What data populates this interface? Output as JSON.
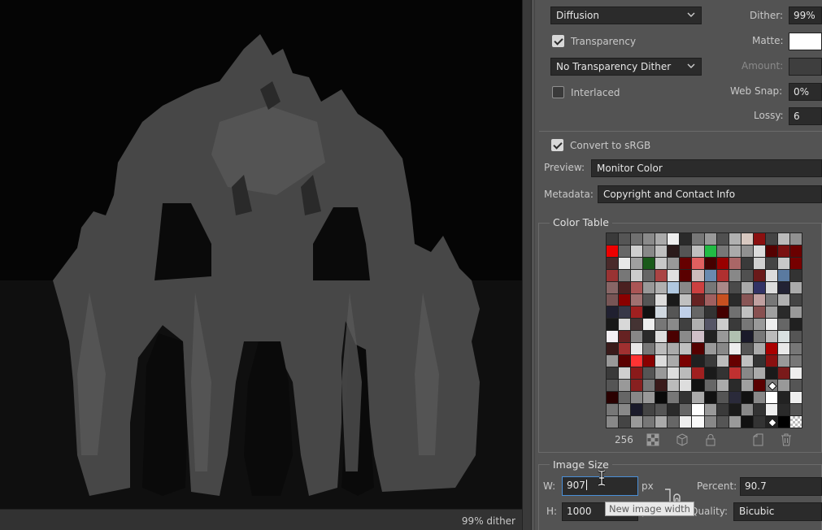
{
  "status": {
    "dither_readout": "99% dither"
  },
  "options": {
    "dither_algorithm": "Diffusion",
    "dither_label": "Dither:",
    "dither_value": "99%",
    "transparency_label": "Transparency",
    "transparency_checked": true,
    "matte_label": "Matte:",
    "matte_color": "#ffffff",
    "transparency_dither": "No Transparency Dither",
    "amount_label": "Amount:",
    "amount_value": "",
    "interlaced_label": "Interlaced",
    "interlaced_checked": false,
    "websnap_label": "Web Snap:",
    "websnap_value": "0%",
    "lossy_label": "Lossy:",
    "lossy_value": "6",
    "srgb_label": "Convert to sRGB",
    "srgb_checked": true,
    "preview_label": "Preview:",
    "preview_value": "Monitor Color",
    "metadata_label": "Metadata:",
    "metadata_value": "Copyright and Contact Info"
  },
  "color_table": {
    "title": "Color Table",
    "count": "256",
    "icons": [
      "web-shift-icon",
      "snap-to-web-icon",
      "lock-color-icon",
      "new-color-icon",
      "trash-icon"
    ],
    "palette": [
      "#3a3a3a",
      "#555",
      "#707070",
      "#8a8a8a",
      "#aaa",
      "#eee",
      "#2a2a2a",
      "#777",
      "#999",
      "#505050",
      "#b0b0b0",
      "#d8c8c0",
      "#8b1010",
      "#444",
      "#bbb",
      "#909090",
      "#e00",
      "#666",
      "#cfcfcf",
      "#888",
      "#c0c0c0",
      "#2a1a1a",
      "#555",
      "#bfbfbf",
      "#22bb44",
      "#777",
      "#aaa",
      "#909090",
      "#dcdcdc",
      "#500",
      "#7a1010",
      "#6a0000",
      "#4a2a2a",
      "#e8e8e8",
      "#a0a0a0",
      "#1a5a1a",
      "#c8c8c8",
      "#999",
      "#600",
      "#e06060",
      "#400",
      "#900",
      "#a66",
      "#3a3a3a",
      "#d0d0d0",
      "#444",
      "#c8c8c8",
      "#700",
      "#993333",
      "#777",
      "#ccc",
      "#666",
      "#aa4444",
      "#e0e0e0",
      "#5a0000",
      "#ccbbbb",
      "#6a8ab0",
      "#b03030",
      "#888",
      "#505050",
      "#6a1a1a",
      "#dcdcdc",
      "#5a7aa0",
      "#333",
      "#886666",
      "#4a2020",
      "#aa5555",
      "#999",
      "#b0b0b0",
      "#b0c8e0",
      "#888",
      "#cc4040",
      "#777",
      "#a88",
      "#4a4a4a",
      "#aaa",
      "#336",
      "#dcdcdc",
      "#223",
      "#aaa",
      "#775555",
      "#8a0000",
      "#a07070",
      "#555",
      "#dcdcdc",
      "#1a1a1a",
      "#c0c0c0",
      "#662222",
      "#a06060",
      "#c85020",
      "#2a2a2a",
      "#885555",
      "#c0a0a0",
      "#777",
      "#b0b0b0",
      "#444",
      "#202030",
      "#383848",
      "#a02020",
      "#111",
      "#d0d8e0",
      "#555",
      "#c0d0e8",
      "#666",
      "#333",
      "#400",
      "#707070",
      "#c0c0c0",
      "#885050",
      "#a0a0a0",
      "#2a2a2a",
      "#999",
      "#181818",
      "#d8d8d8",
      "#443333",
      "#eee",
      "#777",
      "#8a8a8a",
      "#404040",
      "#b0b0b0",
      "#556",
      "#ccc",
      "#3a3a3a",
      "#777",
      "#999",
      "#eee",
      "#666",
      "#202020",
      "#f4f0f4",
      "#662222",
      "#888",
      "#2a2a2a",
      "#ddd",
      "#4a0000",
      "#8a8a8a",
      "#d0c0c8",
      "#222",
      "#999",
      "#b0c0b0",
      "#1a1a2a",
      "#777",
      "#bbb",
      "#d8e0e0",
      "#555",
      "#3a1a1a",
      "#a03030",
      "#e8e8e8",
      "#777",
      "#bbb",
      "#aaa",
      "#c0c0c0",
      "#500",
      "#999",
      "#888",
      "#eee",
      "#555",
      "#aaa",
      "#a00",
      "#e8e8e8",
      "#777",
      "#999",
      "#5a0000",
      "#ff3333",
      "#880000",
      "#dcdcdc",
      "#aaa",
      "#7a0000",
      "#202020",
      "#3a3a3a",
      "#bbb",
      "#600",
      "#c0c0c0",
      "#333",
      "#8a1010",
      "#999",
      "#777",
      "#3a3a3a",
      "#cfcfcf",
      "#8a1a1a",
      "#555",
      "#999",
      "#ddd",
      "#bbb",
      "#a02020",
      "#1a1a1a",
      "#333",
      "#c03030",
      "#888",
      "#aaa",
      "#1a1a1a",
      "#7a1a1a",
      "#eee",
      "#555",
      "#999",
      "#882020",
      "#777",
      "#3a1a1a",
      "#bbb",
      "#ddd",
      "#111",
      "#666",
      "#aaa",
      "#2a2a2a",
      "#a0a0a0",
      "#5a0000",
      "#777",
      "#999",
      "#555",
      "#2a0000",
      "#666",
      "#888",
      "#999",
      "#0a0a0a",
      "#777",
      "#333",
      "#aaa",
      "#111",
      "#555",
      "#2a2a3a",
      "#111",
      "#888",
      "#ffffff",
      "#222",
      "#eee",
      "#777",
      "#888",
      "#1a1a2a",
      "#444",
      "#555",
      "#2a2a2a",
      "#666",
      "#fff",
      "#999",
      "#3a3a3a",
      "#1a1a1a",
      "#888",
      "#333",
      "#eee",
      "#2a2a2a",
      "#555",
      "#888",
      "#444",
      "#999",
      "#777",
      "#aaa",
      "#666",
      "#eee",
      "#fafafa",
      "#888",
      "#555",
      "#999",
      "#111",
      "#333",
      "#222",
      "#000",
      "#transparent"
    ]
  },
  "image_size": {
    "title": "Image Size",
    "w_label": "W:",
    "w_value": "907",
    "h_label": "H:",
    "h_value": "1000",
    "unit": "px",
    "percent_label": "Percent:",
    "percent_value": "90.7",
    "quality_label": "Quality:",
    "quality_value": "Bicubic",
    "tooltip": "New image width"
  }
}
